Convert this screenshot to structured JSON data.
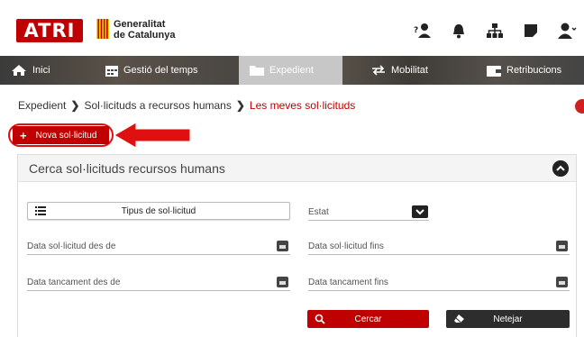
{
  "header": {
    "logo_text": "ATRI",
    "org_line1": "Generalitat",
    "org_line2": "de Catalunya",
    "icons": [
      "user-question-icon",
      "bell-icon",
      "org-chart-icon",
      "note-icon",
      "user-menu-icon"
    ]
  },
  "nav": {
    "items": [
      {
        "label": "Inici",
        "icon": "home-icon"
      },
      {
        "label": "Gestió del temps",
        "icon": "calendar-icon"
      },
      {
        "label": "Expedient",
        "icon": "folder-icon",
        "active": true
      },
      {
        "label": "Mobilitat",
        "icon": "arrows-icon"
      },
      {
        "label": "Retribucions",
        "icon": "wallet-icon"
      }
    ]
  },
  "breadcrumb": {
    "item1": "Expedient",
    "item2": "Sol·licituds a recursos humans",
    "current": "Les meves sol·licituds"
  },
  "new_request": {
    "label": "Nova sol·licitud"
  },
  "search_panel": {
    "title": "Cerca sol·licituds recursos humans",
    "type_button": "Tipus de sol·licitud",
    "status_label": "Estat",
    "date_from_label": "Data sol·licitud des de",
    "date_to_label": "Data sol·licitud fins",
    "close_from_label": "Data tancament des de",
    "close_to_label": "Data tancament fins",
    "search_button": "Cercar",
    "clear_button": "Netejar"
  },
  "colors": {
    "brand_red": "#c00000",
    "dark": "#2d2d2d"
  }
}
